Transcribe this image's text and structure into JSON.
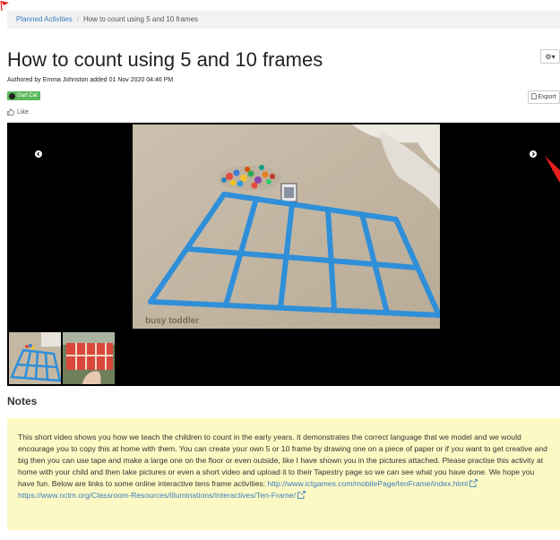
{
  "breadcrumb": {
    "parent": "Planned Activities",
    "separator": "/",
    "current": "How to count using 5 and 10 frames"
  },
  "page": {
    "title": "How to count using 5 and 10 frames",
    "author_line": "Authored by Emma Johnston added 01 Nov 2020 04:46 PM",
    "tag": "Garf Cat",
    "like_label": "Like",
    "export_label": "Export",
    "gear_label": "⚙▾"
  },
  "gallery": {
    "watermark": "busy toddler"
  },
  "notes": {
    "heading": "Notes",
    "body": "This short video shows you how we teach the children to count in the early years. It demonstrates the correct language that we model and we would encourage you to copy this at home with them. You can create your own 5 or 10 frame by drawing one on a piece of paper or if you want to get creative and big then you can use tape and make a large one on the floor or even outside, like I have shown you in the pictures attached. Please practise this activity at home with your child and then take pictures or even a short video and upload it to their Tapestry page so we can see what you have done. We hope you have fun. Below are links to some online interactive tens frame activities:",
    "link1": "http://www.ictgames.com/mobilePage/tenFrame/index.html",
    "link2": "https://www.nctm.org/Classroom-Resources/Illuminations/Interactives/Ten-Frame/"
  },
  "colors": {
    "link": "#3b7bbf",
    "notes_bg": "#fdf9c4",
    "badge": "#5cb85c",
    "tape": "#2f8fd8",
    "arrow": "#e8201c"
  }
}
